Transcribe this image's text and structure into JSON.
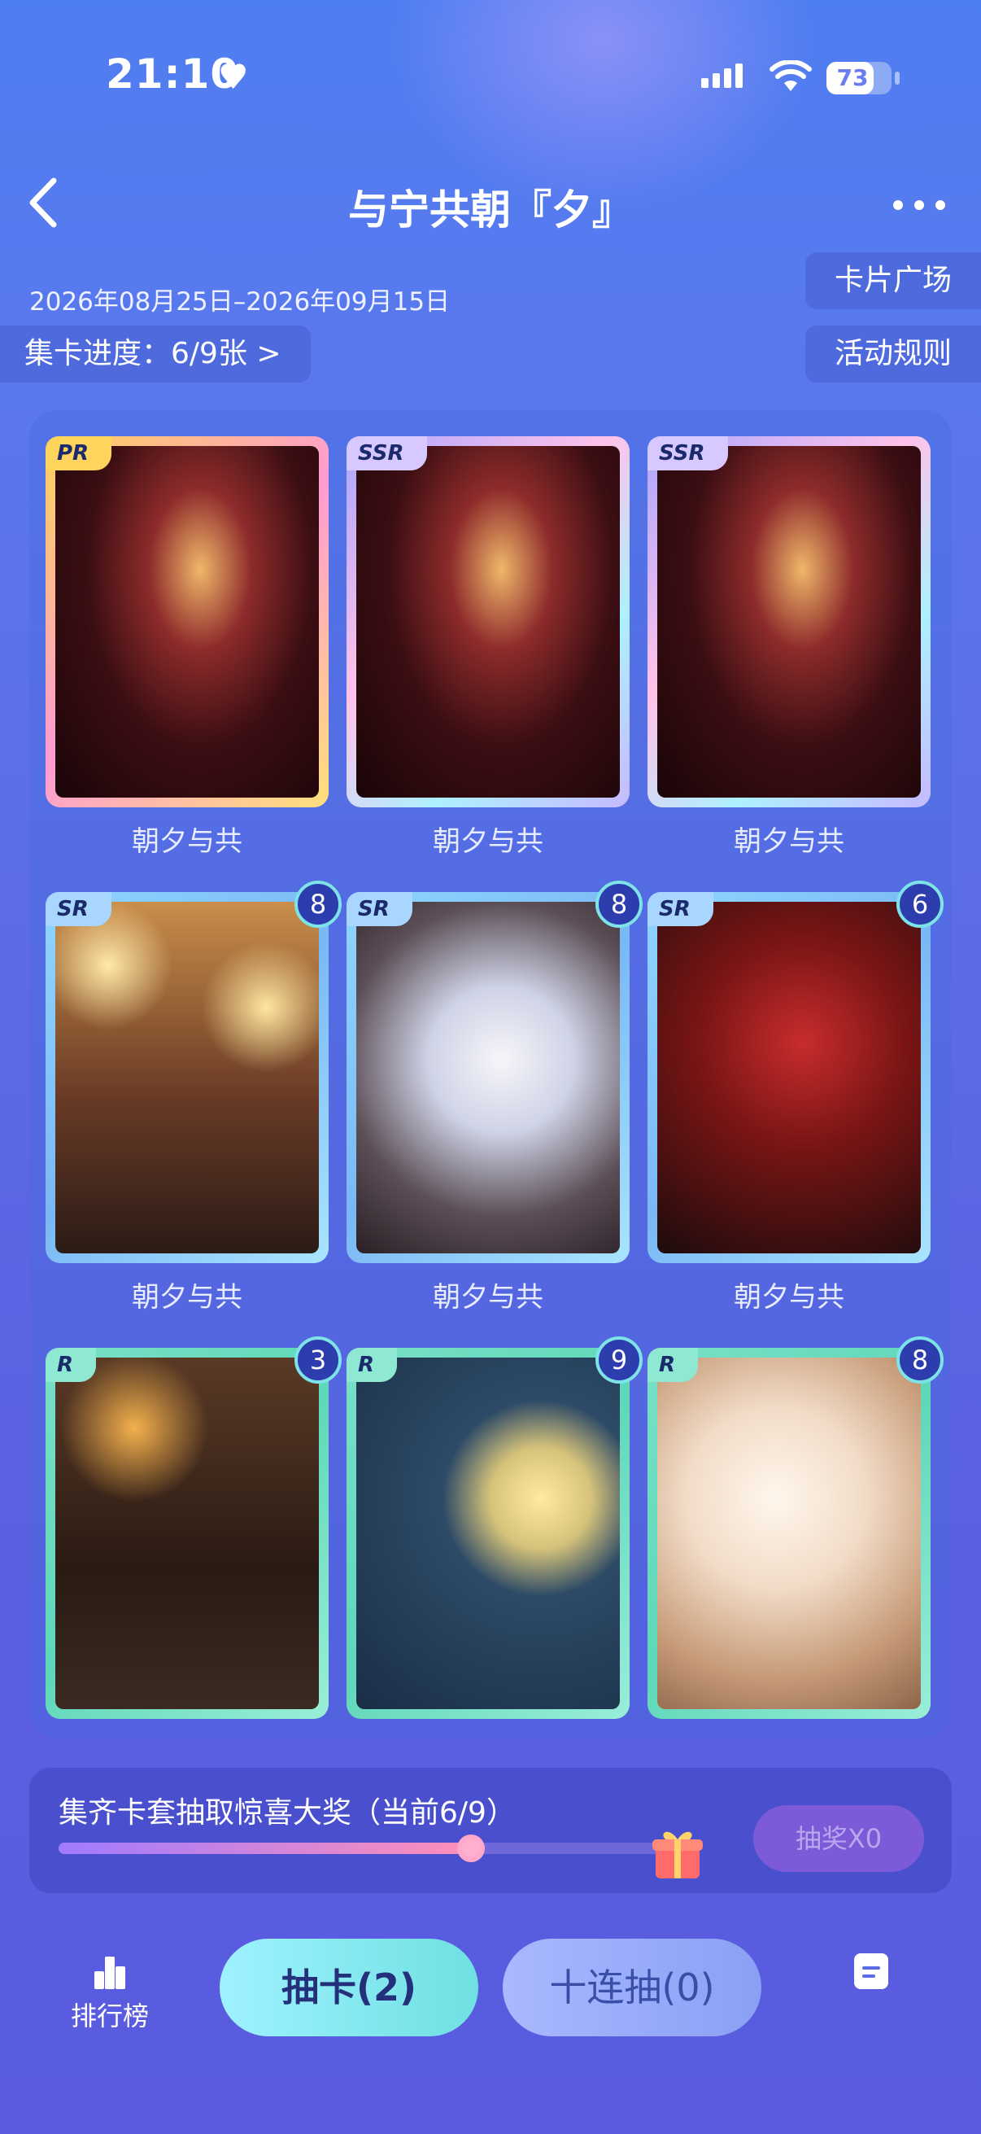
{
  "status_bar": {
    "time": "21:10",
    "battery": "73",
    "battery_level": 0.73
  },
  "header": {
    "title": "与宁共朝『夕』"
  },
  "event": {
    "date_range": "2026年08月25日–2026年09月15日",
    "progress_label": "集卡进度：6/9张 >",
    "card_square_label": "卡片广场",
    "rules_label": "活动规则"
  },
  "cards": [
    {
      "rarity": "PR",
      "name": "朝夕与共",
      "count": null,
      "art": "violin"
    },
    {
      "rarity": "SSR",
      "name": "朝夕与共",
      "count": null,
      "art": "violin"
    },
    {
      "rarity": "SSR",
      "name": "朝夕与共",
      "count": null,
      "art": "violin"
    },
    {
      "rarity": "SR",
      "name": "朝夕与共",
      "count": "8",
      "art": "lantern"
    },
    {
      "rarity": "SR",
      "name": "朝夕与共",
      "count": "8",
      "art": "white"
    },
    {
      "rarity": "SR",
      "name": "朝夕与共",
      "count": "6",
      "art": "red"
    },
    {
      "rarity": "R",
      "name": "",
      "count": "3",
      "art": "dark"
    },
    {
      "rarity": "R",
      "name": "",
      "count": "9",
      "art": "moon"
    },
    {
      "rarity": "R",
      "name": "",
      "count": "8",
      "art": "soft"
    }
  ],
  "collect": {
    "text": "集齐卡套抽取惊喜大奖（当前6/9）",
    "progress": 0.667,
    "lottery_label": "抽奖X0"
  },
  "nav": {
    "rank_label": "排行榜",
    "draw_label": "抽卡(2)",
    "ten_draw_label": "十连抽(0)"
  },
  "colors": {
    "accent_teal": "#6fe0e2",
    "count_badge": "#2d3dae",
    "lottery_disabled": "#7d5bd8"
  }
}
